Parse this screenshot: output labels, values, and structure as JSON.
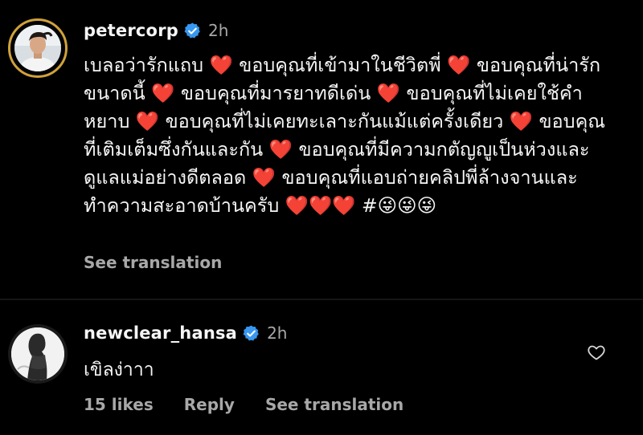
{
  "comments": [
    {
      "username": "petercorp",
      "verified_icon": "verified-badge-icon",
      "time": "2h",
      "text": "เบลอว่ารักแถบ ❤️ ขอบคุณที่เข้ามาในชีวิตพี่ ❤️ ขอบคุณที่น่ารักขนาดนี้ ❤️ ขอบคุณที่มารยาทดีเด่น ❤️ ขอบคุณที่ไม่เคยใช้คำหยาบ ❤️ ขอบคุณที่ไม่เคยทะเลาะกันแม้แต่ครั้งเดียว ❤️ ขอบคุณที่เติมเต็มซึ่งกันและกัน ❤️ ขอบคุณที่มีความกตัญญูเป็นห่วงและดูแลแม่อย่างดีตลอด ❤️ ขอบคุณที่แอบถ่ายคลิปพี่ล้างจานและทำความสะอาดบ้านครับ ❤️❤️❤️ #😜😜😜",
      "see_translation": "See translation",
      "story_ring_color": "#cfa23a"
    },
    {
      "username": "newclear_hansa",
      "verified_icon": "verified-badge-icon",
      "time": "2h",
      "text": "เขิลง่าาา",
      "likes": "15 likes",
      "reply": "Reply",
      "see_translation": "See translation",
      "like_icon": "heart-outline-icon"
    }
  ],
  "colors": {
    "background": "#000000",
    "primary_text": "#f5f5f5",
    "secondary_text": "#a8a8a8",
    "verified_blue": "#3897f0"
  }
}
